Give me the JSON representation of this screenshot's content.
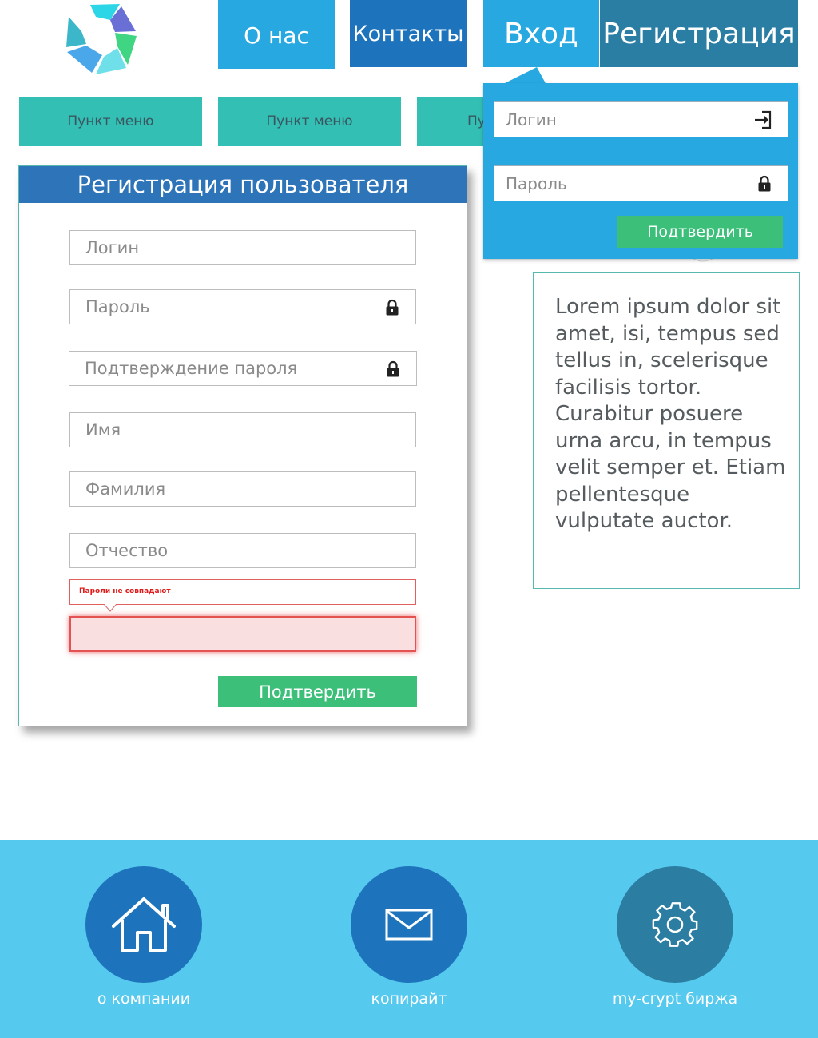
{
  "nav": {
    "about": "О нас",
    "contacts": "Контакты",
    "login": "Вход",
    "register": "Регистрация"
  },
  "menu": {
    "items": [
      "Пункт меню",
      "Пункт меню",
      "Пу"
    ]
  },
  "registration": {
    "title": "Регистрация пользователя",
    "fields": {
      "login": "Логин",
      "password": "Пароль",
      "password_confirm": "Подтверждение пароля",
      "first_name": "Имя",
      "last_name": "Фамилия",
      "patronymic": "Отчество"
    },
    "error_message": "Пароли не совпадают",
    "submit_label": "Подтвердить"
  },
  "login_dropdown": {
    "login_placeholder": "Логин",
    "password_placeholder": "Пароль",
    "submit_label": "Подтвердить"
  },
  "info": {
    "text": "Lorem ipsum dolor sit amet, isi, tempus sed tellus in, scelerisque facilisis tortor. Curabitur posuere urna arcu, in tempus velit semper et. Etiam pellentesque vulputate auctor."
  },
  "footer": {
    "items": [
      {
        "label": "о компании",
        "icon": "home-icon"
      },
      {
        "label": "копирайт",
        "icon": "mail-icon"
      },
      {
        "label": "my-crypt биржа",
        "icon": "gear-icon"
      }
    ]
  },
  "colors": {
    "nav_light_blue": "#27a8e0",
    "nav_dark_blue": "#1e73bd",
    "nav_teal_blue": "#2a7ea3",
    "menu_teal": "#33bfb3",
    "panel_header": "#2e74b8",
    "button_green": "#3bbf79",
    "error_red": "#e01b1b",
    "footer_bg": "#56c9ee"
  }
}
